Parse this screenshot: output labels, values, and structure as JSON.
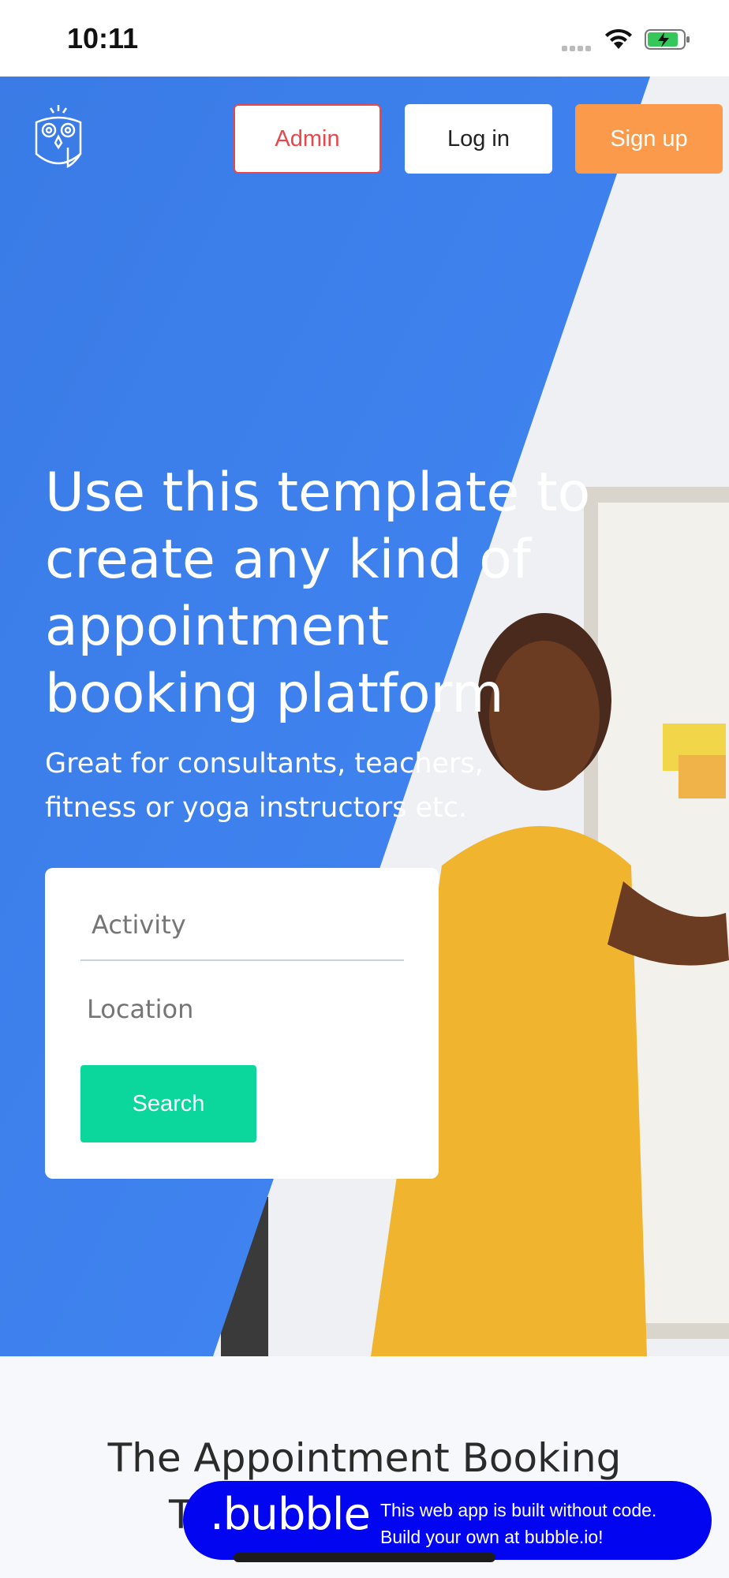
{
  "status_bar": {
    "time": "10:11"
  },
  "header": {
    "logo_icon": "owl-logo-icon",
    "admin_label": "Admin",
    "login_label": "Log in",
    "signup_label": "Sign up"
  },
  "hero": {
    "headline": "Use this template to create any kind of appointment booking platform",
    "subline": "Great for consultants, teachers, fitness or yoga instructors etc."
  },
  "search": {
    "activity_placeholder": "Activity",
    "location_placeholder": "Location",
    "button_label": "Search"
  },
  "section": {
    "title_line1": "The Appointment Booking",
    "title_line2_visible": "T"
  },
  "bubble_badge": {
    "logo_text": ".bubble",
    "line1": "This web app is built without code.",
    "line2": "Build your own at bubble.io!"
  },
  "colors": {
    "hero_blue": "#3e82f0",
    "admin_red": "#e8474c",
    "signup_orange": "#fb9a4b",
    "search_green": "#0bd69b",
    "bubble_blue": "#0205f0"
  }
}
